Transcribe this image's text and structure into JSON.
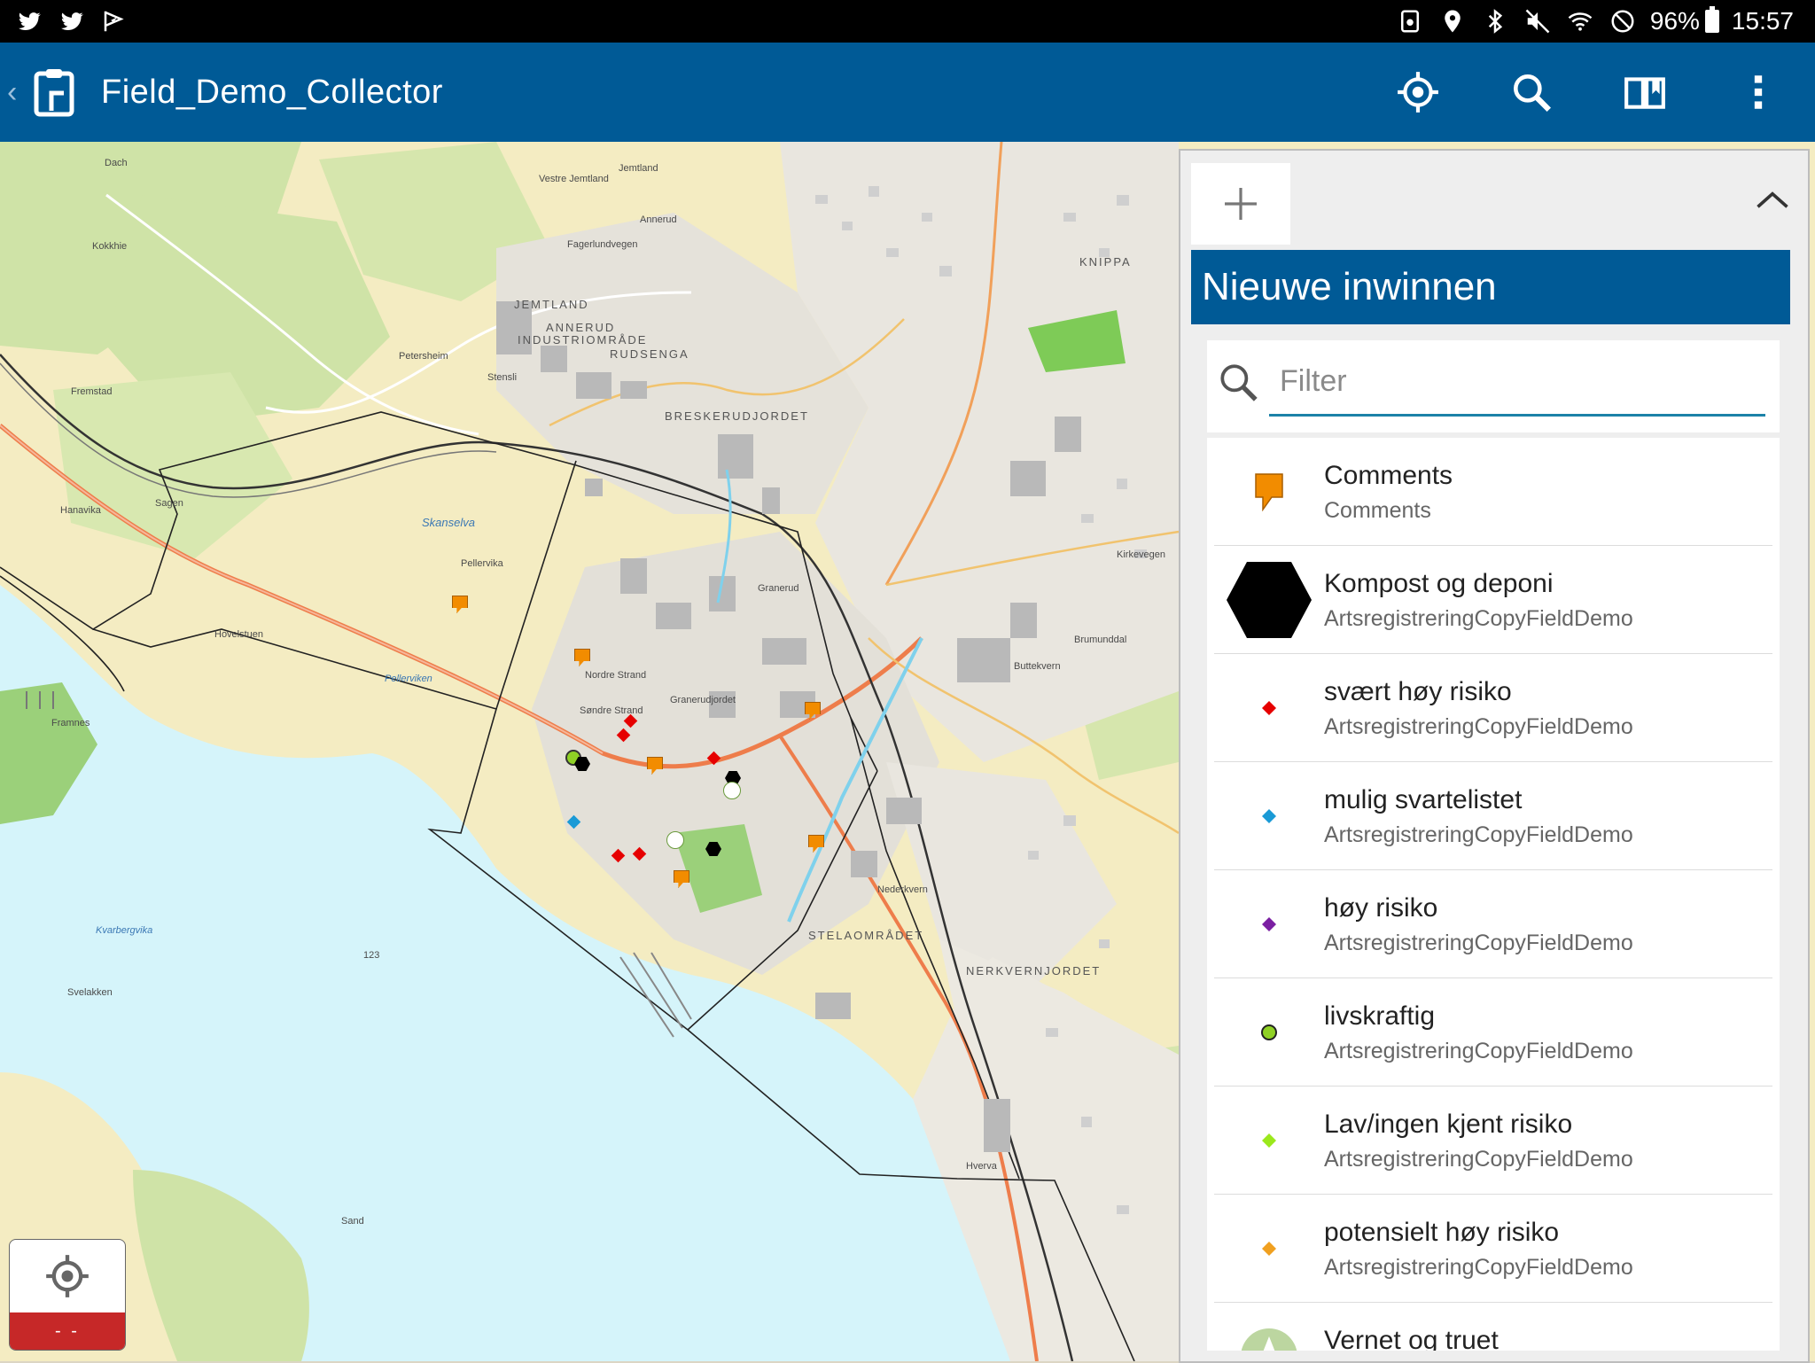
{
  "status_bar": {
    "battery": "96%",
    "time": "15:57",
    "left_icons": [
      "twitter-icon",
      "twitter-icon",
      "flag-icon"
    ],
    "right_icons": [
      "save-icon",
      "location-icon",
      "bluetooth-icon",
      "mute-icon",
      "wifi-icon",
      "block-icon",
      "battery-icon"
    ]
  },
  "app_bar": {
    "title": "Field_Demo_Collector",
    "actions": [
      "my-location-icon",
      "search-icon",
      "bookmarks-icon",
      "more-vert-icon"
    ]
  },
  "panel": {
    "header": "Nieuwe inwinnen",
    "search_placeholder": "Filter",
    "items": [
      {
        "title": "Comments",
        "subtitle": "Comments",
        "symbol": "orange-pin",
        "color": "#f28c00"
      },
      {
        "title": "Kompost og deponi",
        "subtitle": "ArtsregistreringCopyFieldDemo",
        "symbol": "black-hexagon",
        "color": "#000000"
      },
      {
        "title": "svært høy risiko",
        "subtitle": "ArtsregistreringCopyFieldDemo",
        "symbol": "diamond",
        "color": "#e60000"
      },
      {
        "title": "mulig svartelistet",
        "subtitle": "ArtsregistreringCopyFieldDemo",
        "symbol": "diamond",
        "color": "#1a9ad6"
      },
      {
        "title": "høy risiko",
        "subtitle": "ArtsregistreringCopyFieldDemo",
        "symbol": "diamond",
        "color": "#7b1fa2"
      },
      {
        "title": "livskraftig",
        "subtitle": "ArtsregistreringCopyFieldDemo",
        "symbol": "green-circle",
        "color": "#8fd125"
      },
      {
        "title": "Lav/ingen kjent risiko",
        "subtitle": "ArtsregistreringCopyFieldDemo",
        "symbol": "diamond",
        "color": "#9be81c"
      },
      {
        "title": "potensielt høy risiko",
        "subtitle": "ArtsregistreringCopyFieldDemo",
        "symbol": "diamond",
        "color": "#f0a020"
      },
      {
        "title": "Vernet og truet",
        "subtitle": "",
        "symbol": "green-triangle-circle",
        "color": "#bcd6a0"
      }
    ]
  },
  "gps_widget": {
    "accuracy": "- -"
  },
  "map_labels": {
    "jemtland": "JEMTLAND",
    "annerud": "ANNERUD",
    "industriomrade": "INDUSTRIOMRÅDE",
    "rudsenga": "RUDSENGA",
    "breskerudjordet": "BRESKERUDJORDET",
    "knippa": "KNIPPA",
    "stelaomradet": "STELAOMRÅDET",
    "nerkvernjordet": "NERKVERNJORDET",
    "skanselva": "Skanselva",
    "pellerviken": "Pellerviken",
    "kvarbergvika": "Kvarbergvika",
    "framnes": "Framnes",
    "hovelstuen": "Hovelstuen",
    "pellervika": "Pellervika",
    "nordre_strand": "Nordre Strand",
    "sondre_strand": "Søndre Strand",
    "granerud": "Granerud",
    "graneudjordet": "Granerudjordet",
    "svelakken": "Svelakken",
    "stensli": "Stensli",
    "petersheim": "Petersheim",
    "fremstad": "Fremstad",
    "sagen": "Sagen",
    "hanavika": "Hanavika",
    "fagerlundvegen": "Fagerlundvegen",
    "kirkevegen": "Kirkevegen",
    "brumunddal": "Brumunddal",
    "dach": "Dach",
    "jemtland_small": "Jemtland",
    "vestre_jemtland": "Vestre Jemtland",
    "annerud_small": "Annerud",
    "kokkhie": "Kokkhie",
    "sand": "Sand",
    "hverva": "Hverva",
    "nederkvern": "Nederkvern",
    "buttekvern": "Buttekvern",
    "depth_123": "123"
  }
}
